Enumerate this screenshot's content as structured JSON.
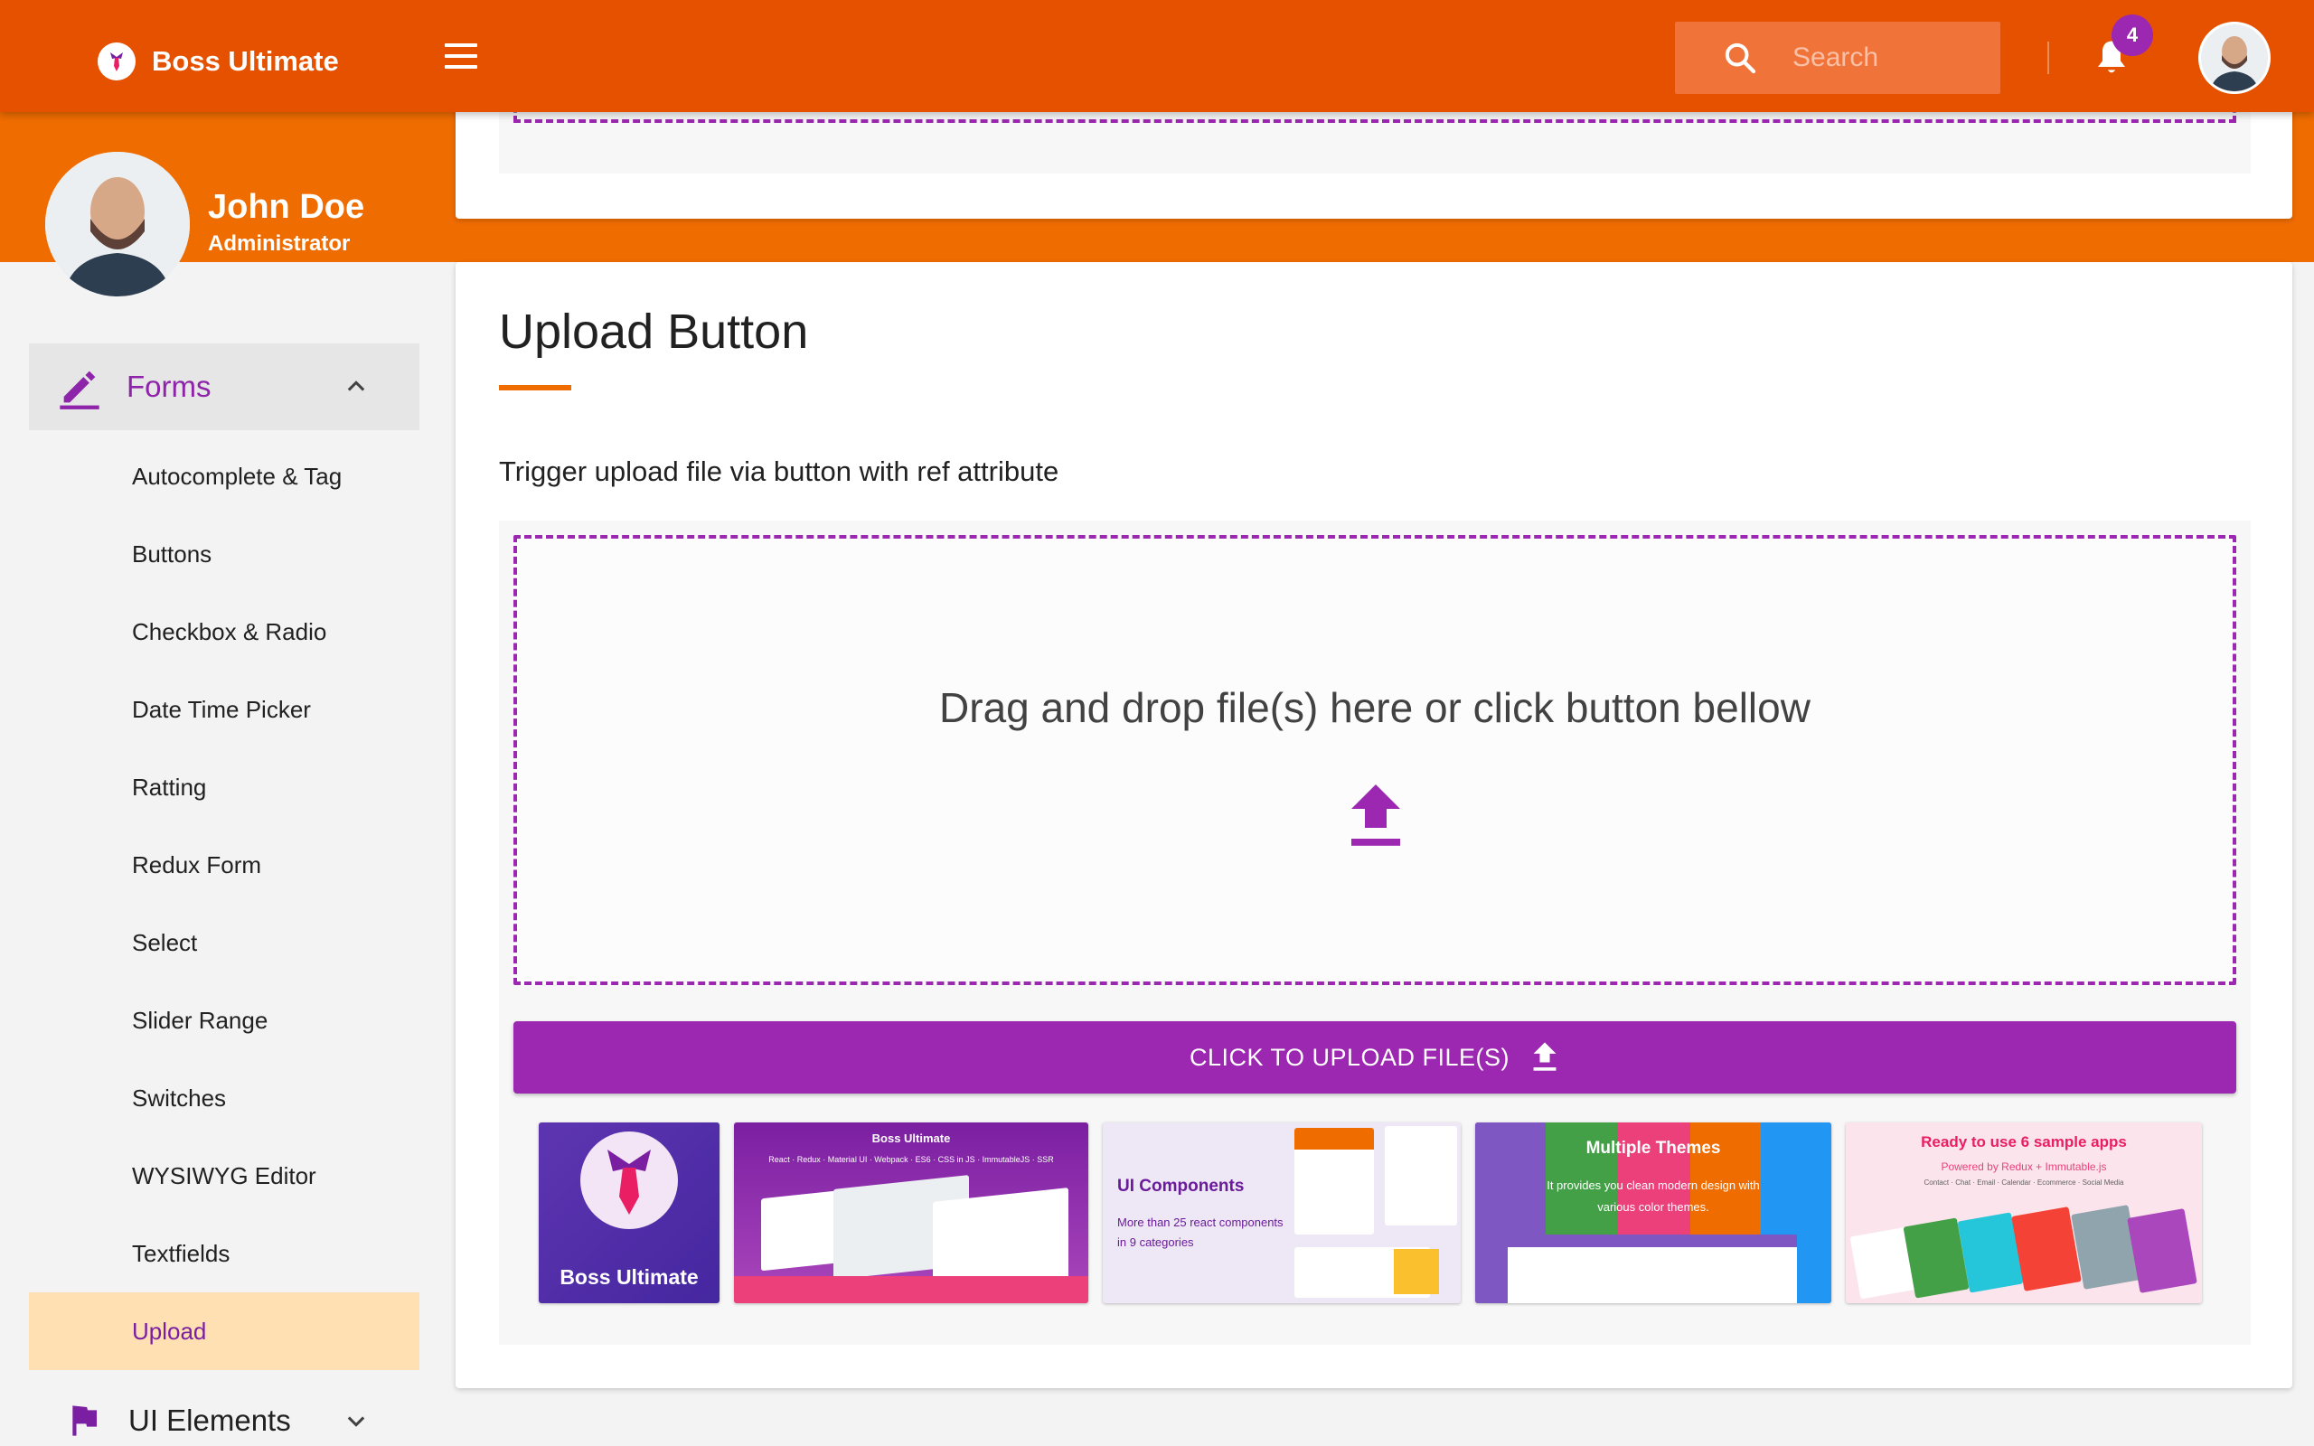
{
  "app": {
    "brand_name": "Boss Ultimate"
  },
  "header": {
    "search_placeholder": "Search",
    "notification_count": "4"
  },
  "profile": {
    "name": "John Doe",
    "role": "Administrator"
  },
  "sidebar": {
    "group_label": "Forms",
    "items": [
      {
        "label": "Autocomplete & Tag"
      },
      {
        "label": "Buttons"
      },
      {
        "label": "Checkbox & Radio"
      },
      {
        "label": "Date Time Picker"
      },
      {
        "label": "Ratting"
      },
      {
        "label": "Redux Form"
      },
      {
        "label": "Select"
      },
      {
        "label": "Slider Range"
      },
      {
        "label": "Switches"
      },
      {
        "label": "WYSIWYG Editor"
      },
      {
        "label": "Textfields"
      },
      {
        "label": "Upload",
        "active": true
      }
    ],
    "group2_label": "UI Elements"
  },
  "main": {
    "title": "Upload Button",
    "description": "Trigger upload file via button with ref attribute",
    "dropzone_text": "Drag and drop file(s) here or click button bellow",
    "upload_button_label": "CLICK TO UPLOAD FILE(S)"
  },
  "thumbnails": [
    {
      "title": "Boss Ultimate"
    },
    {
      "title": "Boss Ultimate",
      "subtitle": "React · Redux · Material UI · Webpack · ES6 · CSS in JS · ImmutableJS · SSR"
    },
    {
      "title": "UI Components",
      "subtitle": "More than 25 react components in 9 categories"
    },
    {
      "title": "Multiple Themes",
      "subtitle": "It provides you clean modern design with various color themes."
    },
    {
      "title": "Ready to use 6 sample apps",
      "subtitle": "Powered by Redux + Immutable.js",
      "note": "Contact · Chat · Email · Calendar · Ecommerce · Social Media"
    }
  ],
  "colors": {
    "appbar": "#e65100",
    "band": "#ef6c00",
    "accent": "#9c27b0",
    "active_bg": "#ffe0b2"
  }
}
